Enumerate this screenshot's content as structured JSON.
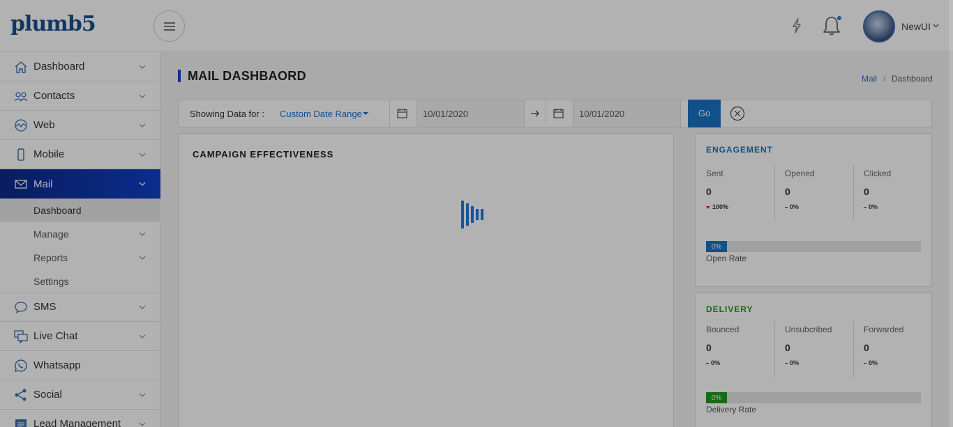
{
  "header": {
    "logo": "plumb5",
    "user_name": "NewUI",
    "icons": {
      "menu": "hamburger-icon",
      "quick": "bolt-icon",
      "notifications": "bell-icon",
      "user": "avatar",
      "caret": "chevron-down-icon"
    }
  },
  "sidebar": {
    "items": [
      {
        "label": "Dashboard",
        "icon": "home-icon"
      },
      {
        "label": "Contacts",
        "icon": "contacts-icon"
      },
      {
        "label": "Web",
        "icon": "web-icon"
      },
      {
        "label": "Mobile",
        "icon": "mobile-icon"
      },
      {
        "label": "Mail",
        "icon": "mail-icon",
        "active": true
      },
      {
        "label": "SMS",
        "icon": "chat-bubble-icon"
      },
      {
        "label": "Live Chat",
        "icon": "live-chat-icon"
      },
      {
        "label": "Whatsapp",
        "icon": "whatsapp-icon"
      },
      {
        "label": "Social",
        "icon": "share-icon"
      },
      {
        "label": "Lead Management",
        "icon": "lead-management-icon"
      }
    ],
    "mail_subitems": [
      {
        "label": "Dashboard",
        "current": true
      },
      {
        "label": "Manage"
      },
      {
        "label": "Reports"
      },
      {
        "label": "Settings"
      }
    ]
  },
  "page": {
    "title": "MAIL DASHBAORD",
    "breadcrumb": {
      "link": "Mail",
      "separator": "/",
      "current": "Dashboard"
    }
  },
  "filter": {
    "showing_label": "Showing Data for :",
    "range_label": "Custom Date Range",
    "from_date": "10/01/2020",
    "to_date": "10/01/2020",
    "go_label": "Go"
  },
  "campaign": {
    "title": "CAMPAIGN EFFECTIVENESS",
    "state": "loading"
  },
  "engagement": {
    "title": "ENGAGEMENT",
    "title_color": "#1a73c8",
    "stats": [
      {
        "label": "Sent",
        "value": "0",
        "change": "100%",
        "trend": "down"
      },
      {
        "label": "Opened",
        "value": "0",
        "change": "0%",
        "trend": "flat"
      },
      {
        "label": "Clicked",
        "value": "0",
        "change": "0%",
        "trend": "flat"
      }
    ],
    "rate_text": "0%",
    "rate_fraction": 0,
    "rate_color": "#1a73c8",
    "rate_label": "Open Rate"
  },
  "delivery": {
    "title": "DELIVERY",
    "title_color": "#1e9b1e",
    "stats": [
      {
        "label": "Bounced",
        "value": "0",
        "change": "0%",
        "trend": "flat"
      },
      {
        "label": "Unsubcribed",
        "value": "0",
        "change": "0%",
        "trend": "flat"
      },
      {
        "label": "Forwarded",
        "value": "0",
        "change": "0%",
        "trend": "flat"
      }
    ],
    "rate_text": "0%",
    "rate_fraction": 0,
    "rate_color": "#1e9b1e",
    "rate_label": "Delivery Rate"
  },
  "colors": {
    "accent": "#1a73c8",
    "nav_active_start": "#0d2a8a",
    "nav_active_end": "#1140c8",
    "overlay": "rgba(0,0,0,0.3)"
  }
}
